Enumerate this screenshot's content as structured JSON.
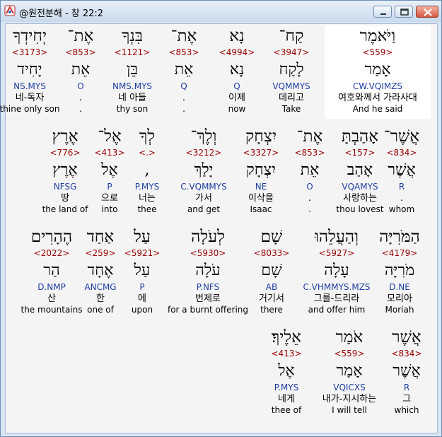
{
  "window": {
    "title": "@원전분해 - 창 22:2",
    "icon": "app-logo-icon",
    "buttons": {
      "minimize": "minimize-icon",
      "maximize": "maximize-icon",
      "close": "close-icon"
    }
  },
  "colors": {
    "number": "#990000",
    "code": "#1f3fa3",
    "highlight_bg": "#ffffff",
    "panel_bg": "#f4f4f4"
  },
  "rows": [
    {
      "words": [
        {
          "heb": "וַיֹּאמֶר",
          "num": "<559>",
          "root": "אָמַר",
          "code": "CW.VQIMZS",
          "kor": "여호와께서 가라사대",
          "eng": "And he said"
        },
        {
          "heb": "קַח־",
          "num": "<3947>",
          "root": "לָקַח",
          "code": "VQMMYS",
          "kor": "데리고",
          "eng": "Take"
        },
        {
          "heb": "נָא",
          "num": "<4994>",
          "root": "נָא",
          "code": "Q",
          "kor": "이제",
          "eng": "now"
        },
        {
          "heb": "אֶת־",
          "num": "<853>",
          "root": "אֵת",
          "code": "Q",
          "kor": ".",
          "eng": "."
        },
        {
          "heb": "בִּנְךָ",
          "num": "<1121>",
          "root": "בֵּן",
          "code": "NMS.MYS",
          "kor": "네 아들",
          "eng": "thy son"
        },
        {
          "heb": "אֶת־",
          "num": "<853>",
          "root": "אֵת",
          "code": "O",
          "kor": ".",
          "eng": "."
        },
        {
          "heb": "יְחִידְךָ",
          "num": "<3173>",
          "root": "יָחִיד",
          "code": "NS.MYS",
          "kor": "네-독자",
          "eng": "thine only son"
        }
      ]
    },
    {
      "words": [
        {
          "heb": "אֲשֶׁר־",
          "num": "<834>",
          "root": "אֲשֶׁר",
          "code": "R",
          "kor": ".",
          "eng": "whom"
        },
        {
          "heb": "אָהַבְתָּ",
          "num": "<157>",
          "root": "אָהַב",
          "code": "VQAMYS",
          "kor": "사랑하는",
          "eng": "thou lovest"
        },
        {
          "heb": "אֶת־",
          "num": "<853>",
          "root": "אֵת",
          "code": "O",
          "kor": ".",
          "eng": "."
        },
        {
          "heb": "יִצְחָק",
          "num": "<3327>",
          "root": "יִצְחָק",
          "code": "NE",
          "kor": "이삭을",
          "eng": "Isaac"
        },
        {
          "heb": "וְלֶךְ־",
          "num": "<3212>",
          "root": "יָלַךְ",
          "code": "C.VQMMYS",
          "kor": "가서",
          "eng": "and get"
        },
        {
          "heb": "לְךָ",
          "num": "<.>",
          "root": ",",
          "code": "P.MYS",
          "kor": "너는",
          "eng": "thee"
        },
        {
          "heb": "אֶל־",
          "num": "<413>",
          "root": "אֶל",
          "code": "P",
          "kor": "으로",
          "eng": "into"
        },
        {
          "heb": "אֶרֶץ",
          "num": "<776>",
          "root": "אֶרֶץ",
          "code": "NFSG",
          "kor": "땅",
          "eng": "the land of"
        }
      ]
    },
    {
      "words": [
        {
          "heb": "הַמֹּרִיָּה",
          "num": "<4179>",
          "root": "מֹרִיָּה",
          "code": "D.NE",
          "kor": "모리아",
          "eng": "Moriah"
        },
        {
          "heb": "וְהַעֲלֵהוּ",
          "num": "<5927>",
          "root": "עָלָה",
          "code": "C.VHMMYS.MZS",
          "kor": "그를-드리라",
          "eng": "and offer him"
        },
        {
          "heb": "שָׁם",
          "num": "<8033>",
          "root": "שָׁם",
          "code": "AB",
          "kor": "거기서",
          "eng": "there"
        },
        {
          "heb": "לְעֹלָה",
          "num": "<5930>",
          "root": "עֹלָה",
          "code": "P.NFS",
          "kor": "번제로",
          "eng": "for a burnt offering"
        },
        {
          "heb": "עַל",
          "num": "<5921>",
          "root": "עַל",
          "code": "P",
          "kor": "에",
          "eng": "upon"
        },
        {
          "heb": "אַחַד",
          "num": "<259>",
          "root": "אֶחָד",
          "code": "ANCMG",
          "kor": "한",
          "eng": "one of"
        },
        {
          "heb": "הֶהָרִים",
          "num": "<2022>",
          "root": "הַר",
          "code": "D.NMP",
          "kor": "산",
          "eng": "the mountains"
        }
      ]
    },
    {
      "words": [
        {
          "heb": "אֲשֶׁר",
          "num": "<834>",
          "root": "אֲשֶׁר",
          "code": "R",
          "kor": "그",
          "eng": "which"
        },
        {
          "heb": "אֹמַר",
          "num": "<559>",
          "root": "אָמַר",
          "code": "VQICXS",
          "kor": "내가-지시하는",
          "eng": "I will tell"
        },
        {
          "heb": "אֵלֶיךָ׃",
          "num": "<413>",
          "root": "אֶל",
          "code": "P.MYS",
          "kor": "네게",
          "eng": "thee of"
        }
      ]
    }
  ]
}
